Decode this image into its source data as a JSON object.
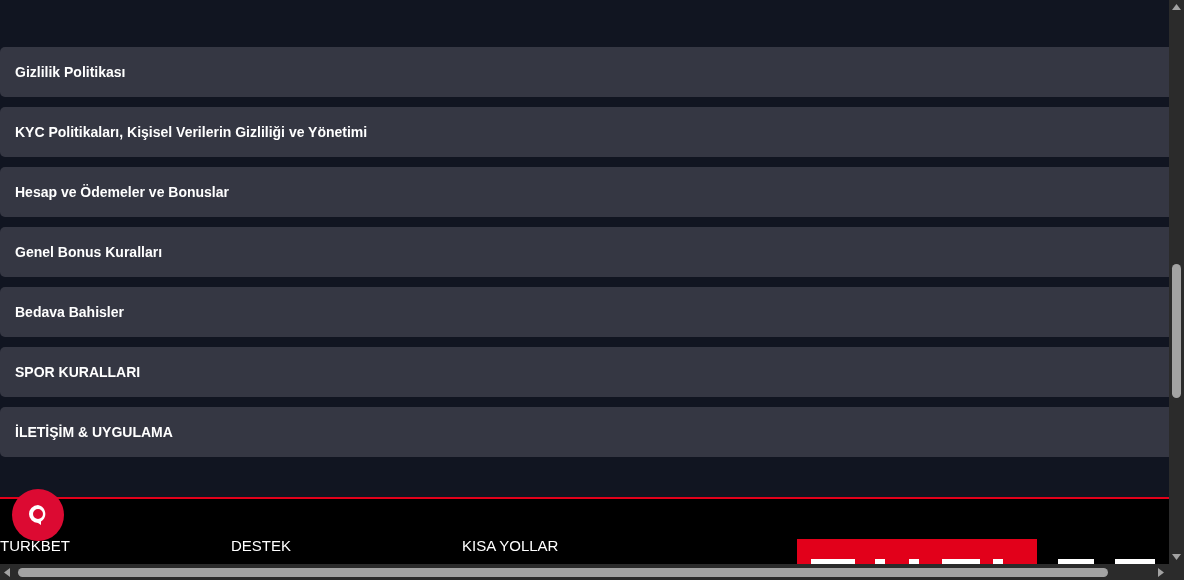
{
  "accordion_items": [
    {
      "label": "Gizlilik Politikası"
    },
    {
      "label": "KYC Politikaları, Kişisel Verilerin Gizliliği ve Yönetimi"
    },
    {
      "label": "Hesap ve Ödemeler ve Bonuslar"
    },
    {
      "label": "Genel Bonus Kuralları"
    },
    {
      "label": "Bedava Bahisler"
    },
    {
      "label": "SPOR KURALLARI"
    },
    {
      "label": "İLETİŞİM & UYGULAMA"
    }
  ],
  "footer": {
    "columns": [
      {
        "heading": "TURKBET"
      },
      {
        "heading": "DESTEK"
      },
      {
        "heading": "KISA YOLLAR"
      }
    ]
  }
}
